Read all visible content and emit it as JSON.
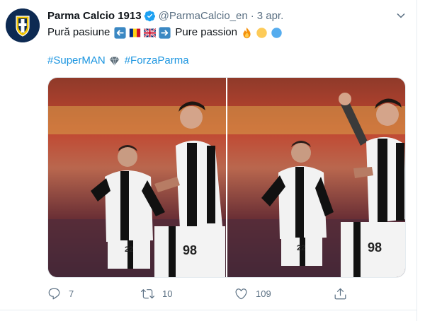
{
  "tweet": {
    "display_name": "Parma Calcio 1913",
    "handle": "@ParmaCalcio_en",
    "separator": "·",
    "date": "3 apr.",
    "text_part1": "Pură pasiune",
    "text_part2": "Pure passion",
    "hashtag1": "#SuperMAN",
    "hashtag2": "#ForzaParma",
    "replies": "7",
    "retweets": "10",
    "likes": "109"
  },
  "icons": {
    "avatar": "parma-crest-logo",
    "verified": "verified-badge-icon",
    "caret": "chevron-down-icon",
    "reply": "reply-icon",
    "retweet": "retweet-icon",
    "like": "heart-icon",
    "share": "share-icon"
  },
  "colors": {
    "accent": "#1b95e0",
    "muted": "#5b7083",
    "border": "#e6ecf0"
  }
}
